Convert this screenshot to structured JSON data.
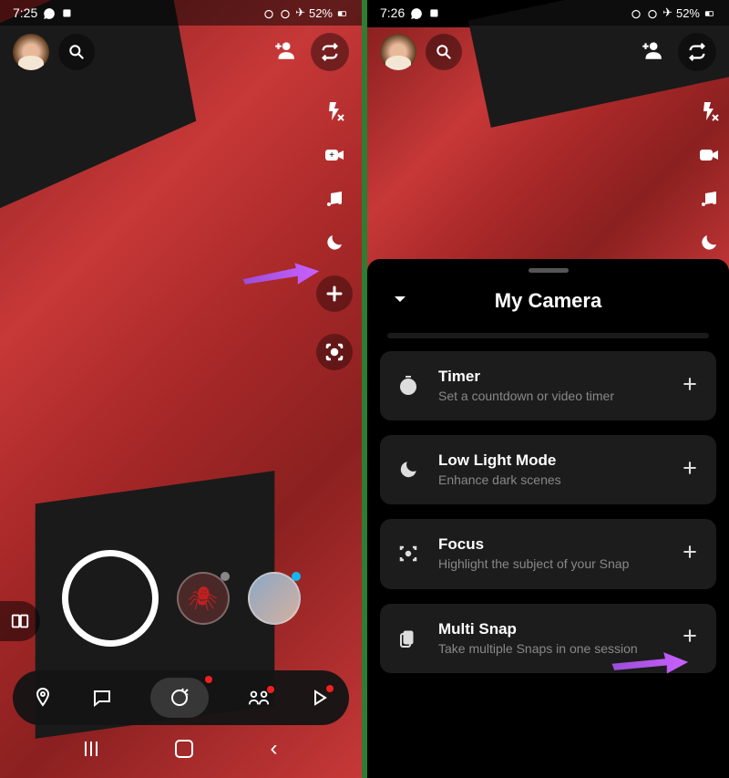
{
  "status": {
    "time_left": "7:25",
    "time_right": "7:26",
    "battery": "52%",
    "flight_icon": "✈"
  },
  "panel": {
    "title": "My Camera",
    "options": [
      {
        "title": "Timer",
        "subtitle": "Set a countdown or video timer"
      },
      {
        "title": "Low Light Mode",
        "subtitle": "Enhance dark scenes"
      },
      {
        "title": "Focus",
        "subtitle": "Highlight the subject of your Snap"
      },
      {
        "title": "Multi Snap",
        "subtitle": "Take multiple Snaps in one session"
      }
    ]
  }
}
